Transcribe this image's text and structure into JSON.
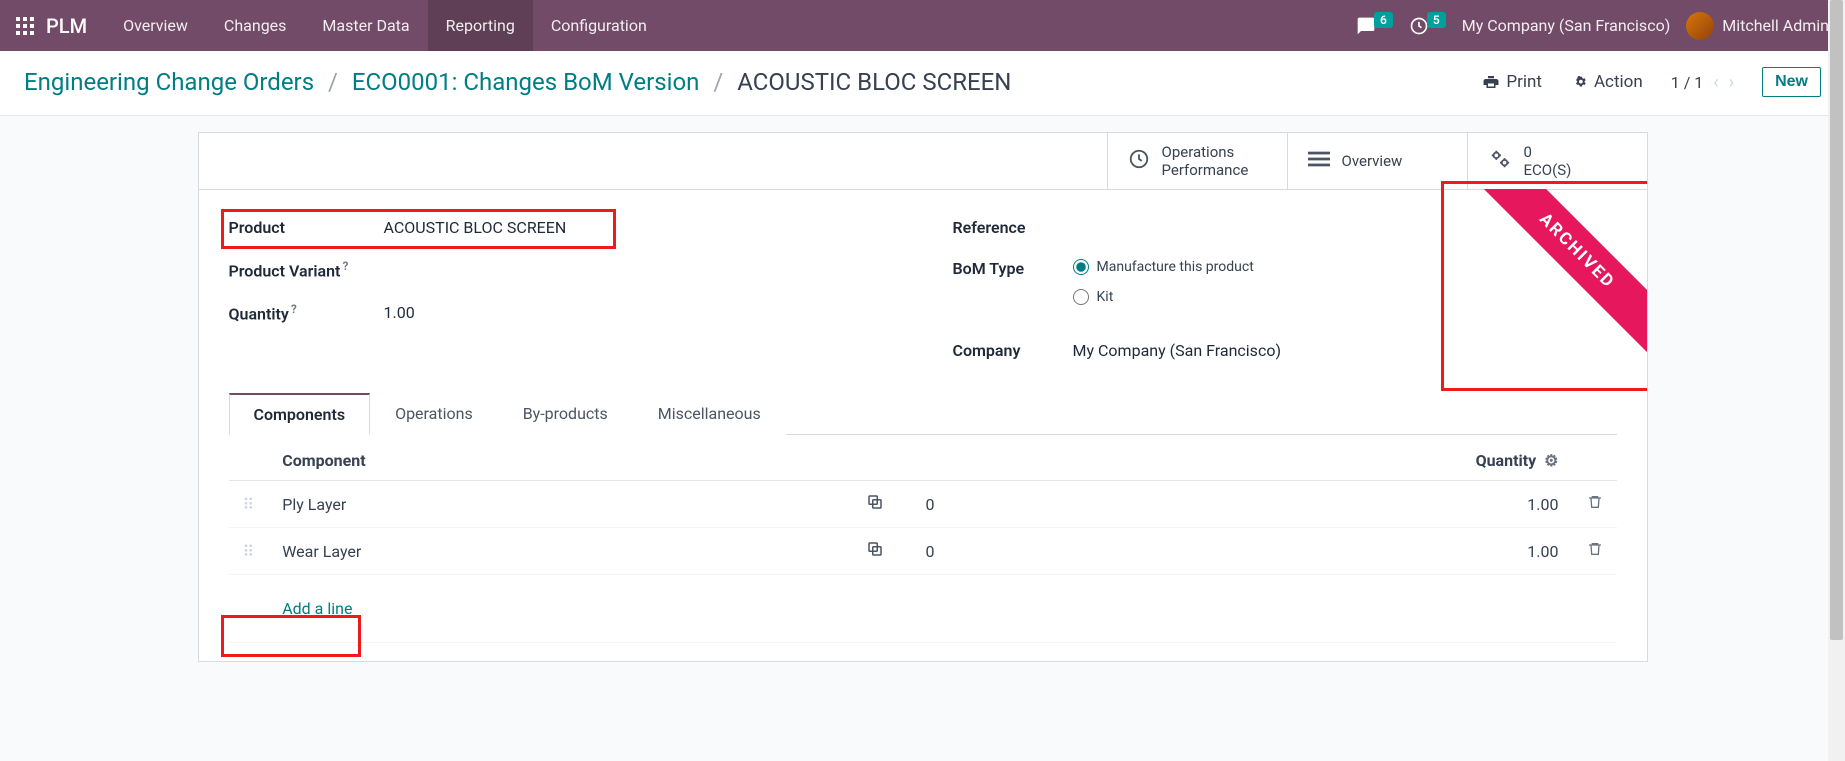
{
  "navbar": {
    "brand": "PLM",
    "items": [
      "Overview",
      "Changes",
      "Master Data",
      "Reporting",
      "Configuration"
    ],
    "active_index": 3,
    "messages_badge": "6",
    "activities_badge": "5",
    "company": "My Company (San Francisco)",
    "user": "Mitchell Admin"
  },
  "breadcrumb": {
    "root": "Engineering Change Orders",
    "mid": "ECO0001: Changes BoM Version",
    "leaf": "ACOUSTIC BLOC SCREEN"
  },
  "controls": {
    "print": "Print",
    "action": "Action",
    "pager": "1 / 1",
    "new": "New"
  },
  "statbar": {
    "ops_perf_l1": "Operations",
    "ops_perf_l2": "Performance",
    "overview": "Overview",
    "eco_count": "0",
    "eco_label": "ECO(S)"
  },
  "ribbon": "ARCHIVED",
  "form": {
    "product_label": "Product",
    "product_value": "ACOUSTIC BLOC SCREEN",
    "variant_label": "Product Variant",
    "qty_label": "Quantity",
    "qty_value": "1.00",
    "reference_label": "Reference",
    "bom_type_label": "BoM Type",
    "bom_type_opt1": "Manufacture this product",
    "bom_type_opt2": "Kit",
    "company_label": "Company",
    "company_value": "My Company (San Francisco)"
  },
  "tabs": [
    "Components",
    "Operations",
    "By-products",
    "Miscellaneous"
  ],
  "table": {
    "col_component": "Component",
    "col_qty": "Quantity",
    "rows": [
      {
        "name": "Ply Layer",
        "used": "0",
        "qty": "1.00"
      },
      {
        "name": "Wear Layer",
        "used": "0",
        "qty": "1.00"
      }
    ],
    "add_line": "Add a line"
  }
}
